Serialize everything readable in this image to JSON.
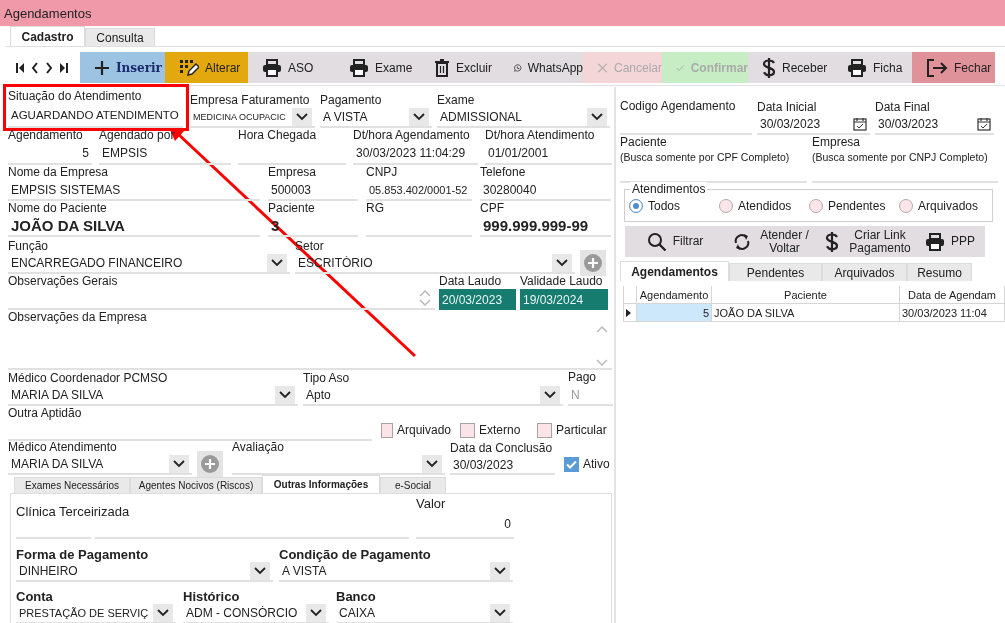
{
  "window": {
    "title": "Agendamentos"
  },
  "main_tabs": [
    {
      "label": "Cadastro",
      "selected": true
    },
    {
      "label": "Consulta",
      "selected": false
    }
  ],
  "toolbar": [
    {
      "label": "Inserir",
      "kind": "insert",
      "disabled": false
    },
    {
      "label": "Alterar",
      "kind": "edit",
      "disabled": false
    },
    {
      "label": "ASO",
      "kind": "default",
      "disabled": false
    },
    {
      "label": "Exame",
      "kind": "default",
      "disabled": false
    },
    {
      "label": "Excluir",
      "kind": "default",
      "disabled": false
    },
    {
      "label": "WhatsApp",
      "kind": "default",
      "disabled": false
    },
    {
      "label": "Cancelar",
      "kind": "cancel",
      "disabled": true
    },
    {
      "label": "Confirmar",
      "kind": "confirm",
      "disabled": true
    },
    {
      "label": "Receber",
      "kind": "default",
      "disabled": false
    },
    {
      "label": "Ficha",
      "kind": "default",
      "disabled": false
    },
    {
      "label": "Fechar",
      "kind": "close",
      "disabled": false
    }
  ],
  "form": {
    "rows": [
      {
        "fields": [
          {
            "label": "Situação do Atendimento",
            "value": "AGUARDANDO ATENDIMENTO",
            "kind": "text",
            "highlighted": true
          },
          {
            "label": "Empresa Faturamento",
            "value": "MEDICINA OCUPACIC",
            "kind": "combo",
            "highlighted": false
          },
          {
            "label": "Pagamento",
            "value": "A VISTA",
            "kind": "combo",
            "highlighted": false
          },
          {
            "label": "Exame",
            "value": "ADMISSIONAL",
            "kind": "combo",
            "highlighted": false
          }
        ]
      },
      {
        "fields": [
          {
            "label": "Agendamento",
            "value": "5",
            "kind": "number"
          },
          {
            "label": "Agendado por",
            "value": "EMPSIS",
            "kind": "text"
          },
          {
            "label": "Hora Chegada",
            "kind": "text"
          },
          {
            "label": "Dt/hora Agendamento",
            "value": "30/03/2023 11:04:29",
            "kind": "text"
          },
          {
            "label": "Dt/hora Atendimento",
            "value": "01/01/2001",
            "kind": "text"
          }
        ]
      },
      {
        "fields": [
          {
            "label": "Nome da Empresa",
            "value": "EMPSIS SISTEMAS",
            "kind": "text"
          },
          {
            "label": "Empresa",
            "value": "500003",
            "kind": "text"
          },
          {
            "label": "CNPJ",
            "value": "05.853.402/0001-52",
            "kind": "text"
          },
          {
            "label": "Telefone",
            "value": "30280040",
            "kind": "text"
          }
        ]
      },
      {
        "fields": [
          {
            "label": "Nome do Paciente",
            "value": "JOÃO DA SILVA",
            "kind": "text",
            "bold": true
          },
          {
            "label": "Paciente",
            "value": "3",
            "kind": "text",
            "bold": true
          },
          {
            "label": "RG",
            "kind": "text"
          },
          {
            "label": "CPF",
            "value": "999.999.999-99",
            "kind": "text",
            "bold": true
          }
        ]
      },
      {
        "fields": [
          {
            "label": "Função",
            "value": "ENCARREGADO FINANCEIRO",
            "kind": "combo"
          },
          {
            "label": "Setor",
            "value": "ESCRITÓRIO",
            "kind": "combo"
          },
          {
            "kind": "add"
          }
        ]
      },
      {
        "fields": [
          {
            "label": "Observações Gerais",
            "kind": "memo"
          },
          {
            "label": "Data Laudo",
            "value": "20/03/2023",
            "kind": "accent"
          },
          {
            "label": "Validade Laudo",
            "value": "19/03/2024",
            "kind": "accent"
          }
        ]
      },
      {
        "fields": [
          {
            "label": "Observações da Empresa",
            "kind": "memo"
          }
        ]
      },
      {
        "fields": [
          {
            "label": "Médico Coordenador PCMSO",
            "value": "MARIA DA SILVA",
            "kind": "combo"
          },
          {
            "label": "Tipo Aso",
            "value": "Apto",
            "kind": "combo"
          },
          {
            "label": "Pago",
            "value": "N",
            "kind": "readonly"
          }
        ]
      },
      {
        "fields": [
          {
            "label": "Outra Aptidão",
            "kind": "text"
          },
          {
            "label": "Arquivado",
            "kind": "checkbox",
            "checked": false
          },
          {
            "label": "Externo",
            "kind": "checkbox",
            "checked": false
          },
          {
            "label": "Particular",
            "kind": "checkbox",
            "checked": false
          }
        ]
      },
      {
        "fields": [
          {
            "label": "Médico Atendimento",
            "value": "MARIA DA SILVA",
            "kind": "combo"
          },
          {
            "kind": "add"
          },
          {
            "label": "Avaliação",
            "kind": "combo"
          },
          {
            "label": "Data da Conclusão",
            "value": "30/03/2023",
            "kind": "text"
          },
          {
            "label": "Ativo",
            "kind": "checkbox",
            "checked": true
          }
        ]
      }
    ]
  },
  "sub_tabs": [
    {
      "label": "Exames Necessários",
      "selected": false
    },
    {
      "label": "Agentes Nocivos (Riscos)",
      "selected": false
    },
    {
      "label": "Outras Informações",
      "selected": true
    },
    {
      "label": "e-Social",
      "selected": false
    }
  ],
  "sub_form": {
    "rows": [
      {
        "fields": [
          {
            "label": "Clínica Terceirizada",
            "kind": "pair"
          },
          {
            "label": "Valor",
            "value": "0",
            "kind": "number"
          }
        ]
      },
      {
        "fields": [
          {
            "label": "Forma de Pagamento",
            "value": "DINHEIRO",
            "kind": "combo",
            "label_bold": true
          },
          {
            "label": "Condição de Pagamento",
            "value": "A VISTA",
            "kind": "combo",
            "label_bold": true
          }
        ]
      },
      {
        "fields": [
          {
            "label": "Conta",
            "value": "PRESTAÇÃO DE SERVIÇ",
            "kind": "combo",
            "label_bold": true
          },
          {
            "label": "Histórico",
            "value": "ADM - CONSÓRCIO",
            "kind": "combo",
            "label_bold": true
          },
          {
            "label": "Banco",
            "value": "CAIXA",
            "kind": "combo",
            "label_bold": true
          }
        ]
      }
    ]
  },
  "search": {
    "rows": [
      {
        "fields": [
          {
            "label": "Codigo Agendamento",
            "kind": "text"
          },
          {
            "label": "Data Inicial",
            "value": "30/03/2023",
            "kind": "date"
          },
          {
            "label": "Data Final",
            "value": "30/03/2023",
            "kind": "date"
          }
        ]
      },
      {
        "fields": [
          {
            "label": "Paciente",
            "note": "(Busca somente por CPF Completo)",
            "kind": "text"
          },
          {
            "label": "Empresa",
            "note": "(Busca somente por CNPJ Completo)",
            "kind": "text"
          }
        ]
      }
    ],
    "filter_group": {
      "title": "Atendimentos",
      "options": [
        {
          "label": "Todos",
          "selected": true
        },
        {
          "label": "Atendidos",
          "selected": false
        },
        {
          "label": "Pendentes",
          "selected": false
        },
        {
          "label": "Arquivados",
          "selected": false
        }
      ]
    },
    "actions": [
      {
        "label": "Filtrar"
      },
      {
        "label": "Atender / Voltar"
      },
      {
        "label": "Criar Link Pagamento"
      },
      {
        "label": "PPP"
      }
    ]
  },
  "result_tabs": [
    {
      "label": "Agendamentos",
      "selected": true
    },
    {
      "label": "Pendentes",
      "selected": false
    },
    {
      "label": "Arquivados",
      "selected": false
    },
    {
      "label": "Resumo",
      "selected": false
    }
  ],
  "grid": {
    "columns": [
      "Agendamento",
      "Paciente",
      "Data de Agendam"
    ],
    "rows": [
      {
        "selected": true,
        "cells": [
          "5",
          "JOÃO DA SILVA",
          "30/03/2023 11:04"
        ]
      }
    ]
  }
}
